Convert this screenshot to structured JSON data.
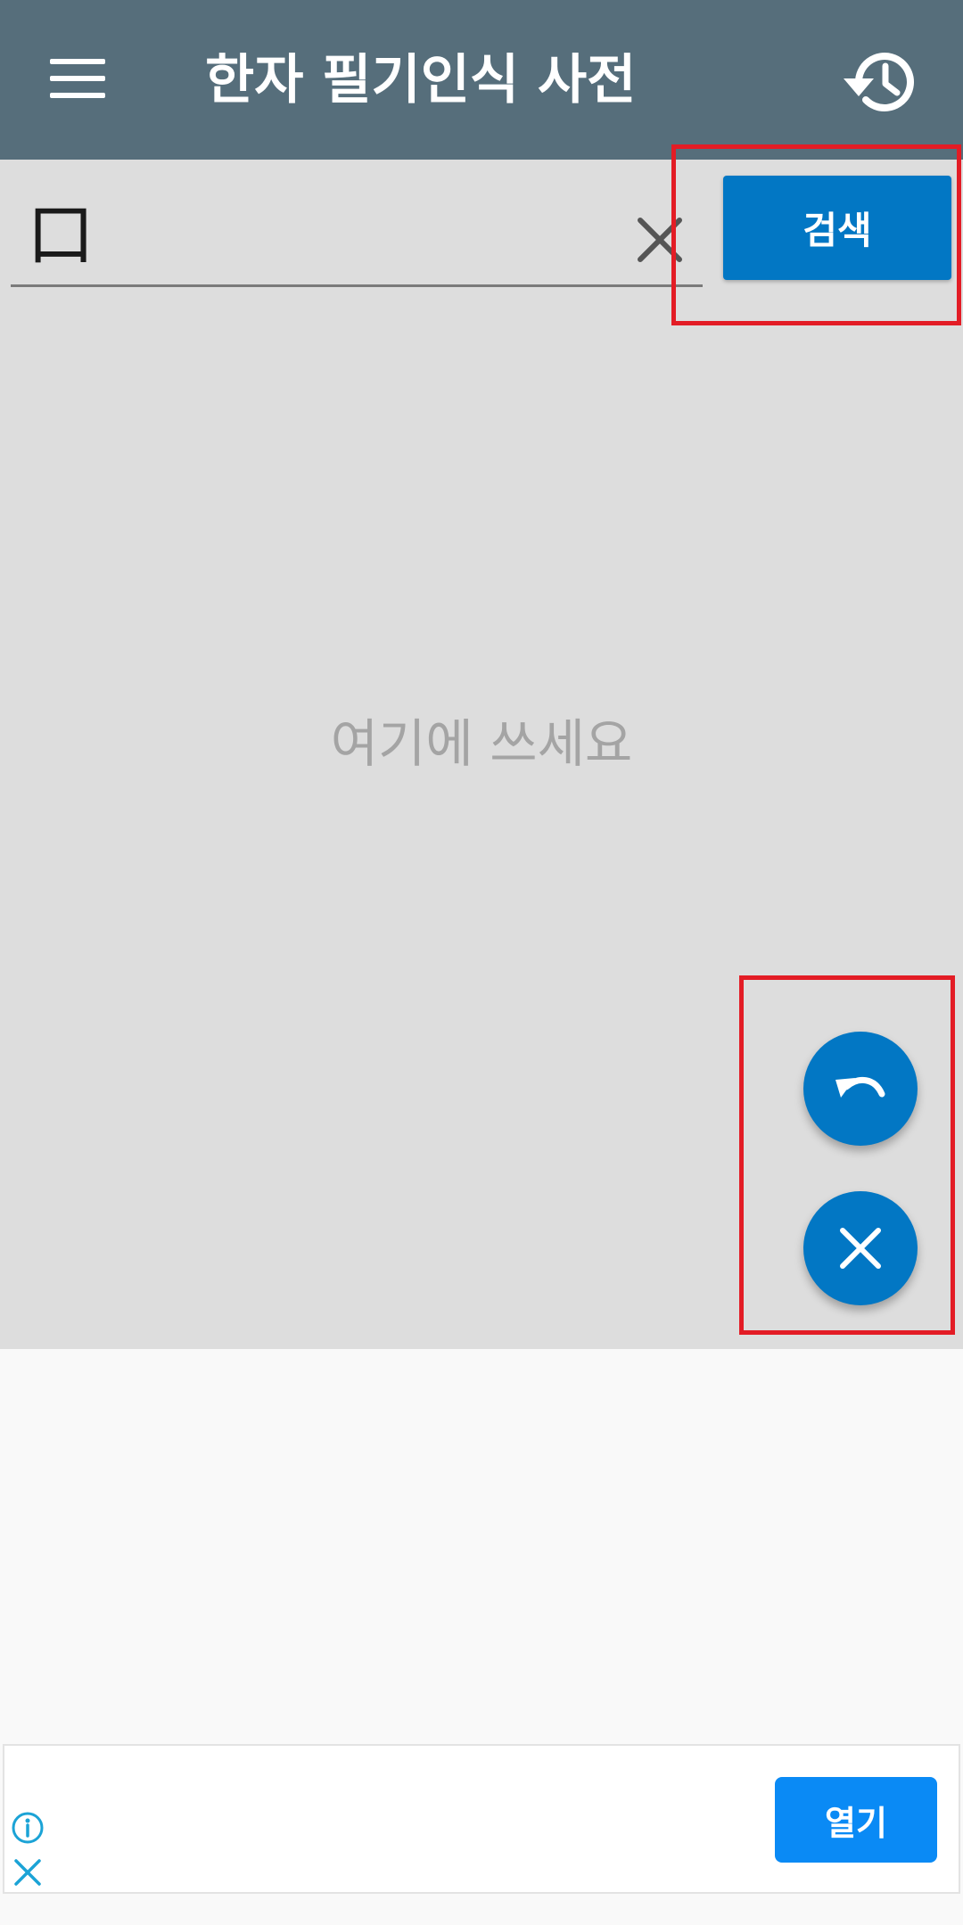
{
  "appbar": {
    "title": "한자 필기인식 사전",
    "menu_icon": "menu-icon",
    "history_icon": "history-icon",
    "background": "#566e7b"
  },
  "search": {
    "value": "口",
    "clear_icon": "close-icon",
    "button_label": "검색"
  },
  "canvas": {
    "hint": "여기에 쓰세요",
    "background": "#dddddd",
    "undo_icon": "undo-icon",
    "clear_icon": "close-icon"
  },
  "ad": {
    "open_label": "열기",
    "info_icon": "info-icon",
    "close_icon": "close-icon"
  },
  "colors": {
    "accent": "#0277c4",
    "highlight": "#e31c25",
    "ad_button": "#0a8af5"
  }
}
